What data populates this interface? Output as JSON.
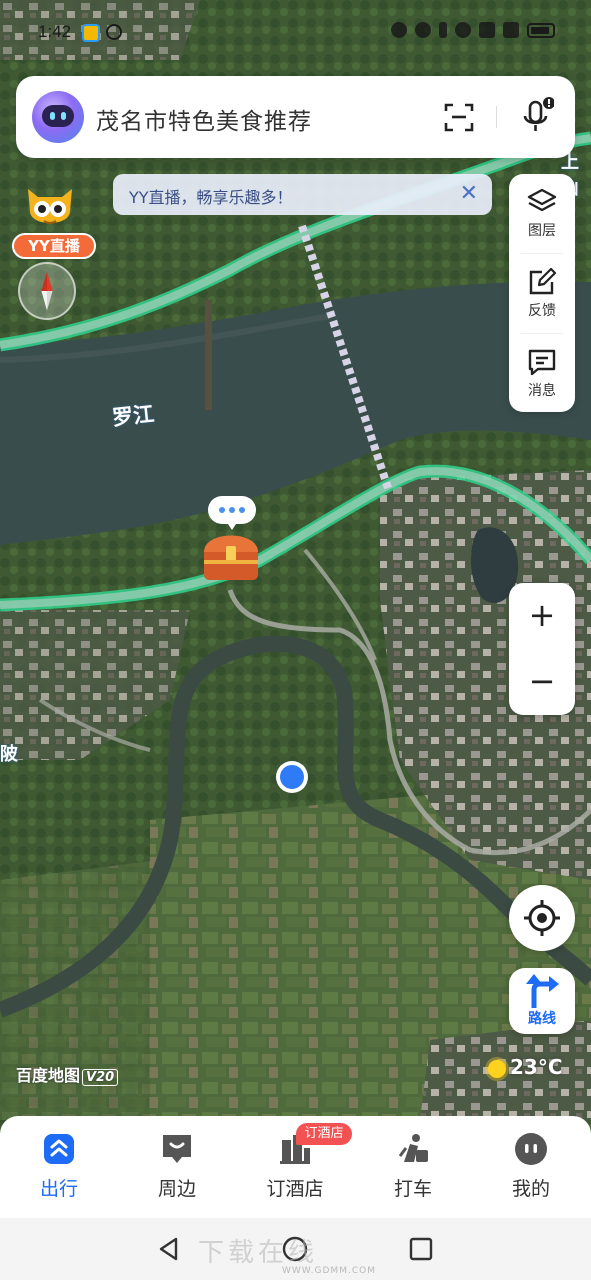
{
  "status_bar": {
    "time": "1:42"
  },
  "search": {
    "text": "茂名市特色美食推荐"
  },
  "yy_banner": {
    "text": "YY直播，畅享乐趣多！",
    "close_label": "✕"
  },
  "yy_tag": {
    "label": "YY直播"
  },
  "tools": [
    {
      "label": "图层",
      "icon": "layers-icon"
    },
    {
      "label": "反馈",
      "icon": "feedback-icon"
    },
    {
      "label": "消息",
      "icon": "message-icon"
    }
  ],
  "zoom": {
    "in_label": "+",
    "out_label": "−"
  },
  "route": {
    "label": "路线"
  },
  "map": {
    "river_label": "罗江",
    "edge_label_top": "上山",
    "edge_label_left": "陂",
    "watermark": "百度地图",
    "watermark_version": "V20",
    "location_color": "#2f7bf5"
  },
  "weather": {
    "temp": "23°C"
  },
  "bottom_nav": [
    {
      "label": "出行",
      "icon": "trip-icon",
      "active": true
    },
    {
      "label": "周边",
      "icon": "nearby-icon",
      "active": false
    },
    {
      "label": "订酒店",
      "icon": "hotel-icon",
      "active": false
    },
    {
      "label": "打车",
      "icon": "taxi-icon",
      "active": false
    },
    {
      "label": "我的",
      "icon": "profile-icon",
      "active": false
    }
  ],
  "hotel_badge": "订酒店",
  "system_watermark": "下载在线",
  "system_watermark_url": "WWW.GDMM.COM"
}
